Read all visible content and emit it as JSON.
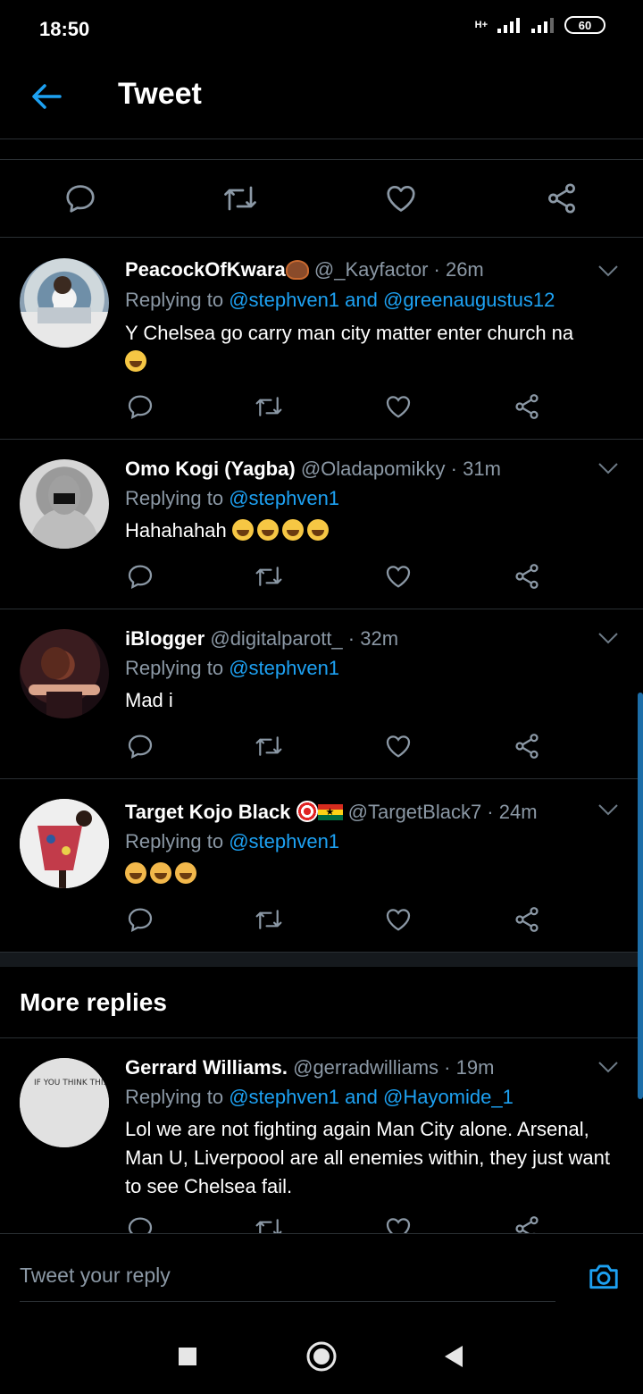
{
  "status": {
    "time": "18:50",
    "network": "H+",
    "battery": "60"
  },
  "header": {
    "title": "Tweet"
  },
  "main_actions": [
    "reply-icon",
    "retweet-icon",
    "like-icon",
    "share-icon"
  ],
  "tweets": [
    {
      "name": "PeacockOfKwara",
      "handle": "@_Kayfactor",
      "time": "26m",
      "replying_prefix": "Replying to ",
      "mention1": "@stephven1",
      "joiner": " and ",
      "mention2": "@greenaugustus12",
      "text": "Y Chelsea go carry man city matter enter church na"
    },
    {
      "name": "Omo Kogi (Yagba)",
      "handle": "@Oladapomikky",
      "time": "31m",
      "replying_prefix": "Replying to ",
      "mention1": "@stephven1",
      "text": "Hahahahah"
    },
    {
      "name": "iBlogger",
      "handle": "@digitalparott_",
      "time": "32m",
      "replying_prefix": "Replying to ",
      "mention1": "@stephven1",
      "text": "Mad i"
    },
    {
      "name": "Target Kojo Black",
      "handle": "@TargetBlack7",
      "time": "24m",
      "replying_prefix": "Replying to ",
      "mention1": "@stephven1",
      "text": ""
    },
    {
      "name": "Gerrard Williams.",
      "handle": "@gerradwilliams",
      "time": "19m",
      "replying_prefix": "Replying to ",
      "mention1": "@stephven1",
      "joiner": " and ",
      "mention2": "@Hayomide_1",
      "text": "Lol we are not fighting again Man City alone. Arsenal, Man U, Liverpoool are all enemies within, they just want to see Chelsea fail."
    }
  ],
  "avatar_sign_text": "IF YOU THINK THIS IS BAD YOU SHOULD SEE WHAT OUR GOVERNMENT IS UP TO",
  "more_replies": {
    "title": "More replies"
  },
  "reply_bar": {
    "placeholder": "Tweet your reply"
  },
  "colors": {
    "accent": "#1da1f2",
    "muted": "#8b98a5",
    "divider": "#2a2f33",
    "background": "#000000"
  }
}
